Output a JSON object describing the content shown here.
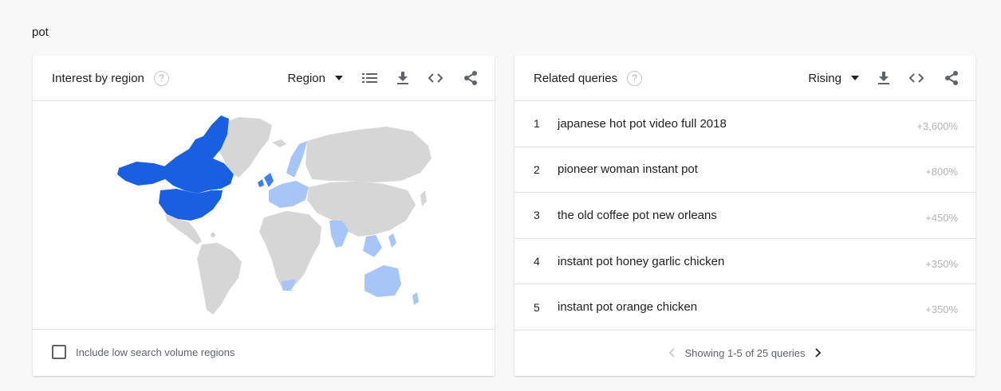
{
  "search_term": "pot",
  "region_card": {
    "title": "Interest by region",
    "help_icon": "?",
    "dropdown_label": "Region",
    "footer_checkbox_label": "Include low search volume regions",
    "icons": [
      "help-icon",
      "list-icon",
      "download-icon",
      "embed-icon",
      "share-icon"
    ]
  },
  "queries_card": {
    "title": "Related queries",
    "help_icon": "?",
    "dropdown_label": "Rising",
    "icons": [
      "help-icon",
      "download-icon",
      "embed-icon",
      "share-icon"
    ],
    "items": [
      {
        "rank": "1",
        "query": "japanese hot pot video full 2018",
        "value": "+3,600%"
      },
      {
        "rank": "2",
        "query": "pioneer woman instant pot",
        "value": "+800%"
      },
      {
        "rank": "3",
        "query": "the old coffee pot new orleans",
        "value": "+450%"
      },
      {
        "rank": "4",
        "query": "instant pot honey garlic chicken",
        "value": "+350%"
      },
      {
        "rank": "5",
        "query": "instant pot orange chicken",
        "value": "+350%"
      }
    ],
    "pagination": "Showing 1-5 of 25 queries"
  },
  "colors": {
    "strong": "#1a5fe0",
    "medium": "#3f7ff0",
    "light": "#a7c5f6",
    "none": "#d6d6d6"
  }
}
